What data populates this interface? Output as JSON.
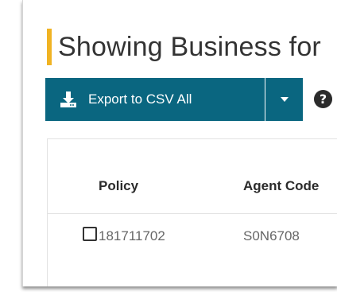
{
  "page": {
    "title": "Showing Business for"
  },
  "toolbar": {
    "export_label": "Export to CSV All",
    "export_icon": "download-icon",
    "dropdown_icon": "caret-down-icon",
    "help_icon": "question-circle-icon"
  },
  "table": {
    "columns": [
      "Policy",
      "Agent Code"
    ],
    "rows": [
      {
        "policy": "181711702",
        "agent_code": "S0N6708"
      }
    ]
  },
  "colors": {
    "accent": "#f0b323",
    "button": "#0a6680"
  }
}
